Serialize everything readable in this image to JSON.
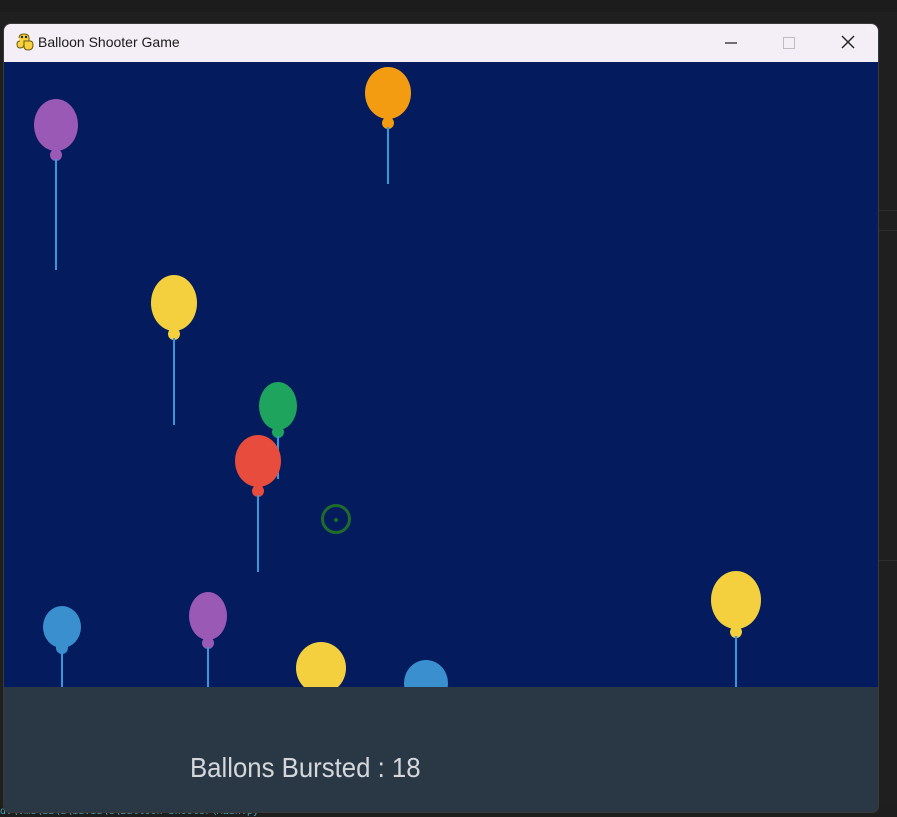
{
  "window": {
    "title": "Balloon Shooter Game",
    "app_icon": "pygame-snake-icon"
  },
  "controls": {
    "minimize_icon": "minimize-icon",
    "maximize_icon": "maximize-icon",
    "close_icon": "close-icon"
  },
  "game": {
    "background_color": "#041c5d",
    "panel_color": "#2a3845",
    "crosshair_color": "#1f6b2c",
    "balloons": [
      {
        "color": "#9b59b6"
      },
      {
        "color": "#f39c12"
      },
      {
        "color": "#f4d03f"
      },
      {
        "color": "#1fa45d"
      },
      {
        "color": "#e74c3c"
      },
      {
        "color": "#3a8fcf"
      },
      {
        "color": "#9b59b6"
      },
      {
        "color": "#f4d03f"
      },
      {
        "color": "#3a8fcf"
      },
      {
        "color": "#f4d03f"
      }
    ]
  },
  "score": {
    "label": "Ballons Bursted : 18"
  },
  "background_text": "d:\\vmd\\aa\\a\\ia.ia\\e\\Balloon Shooter\\Main.py"
}
